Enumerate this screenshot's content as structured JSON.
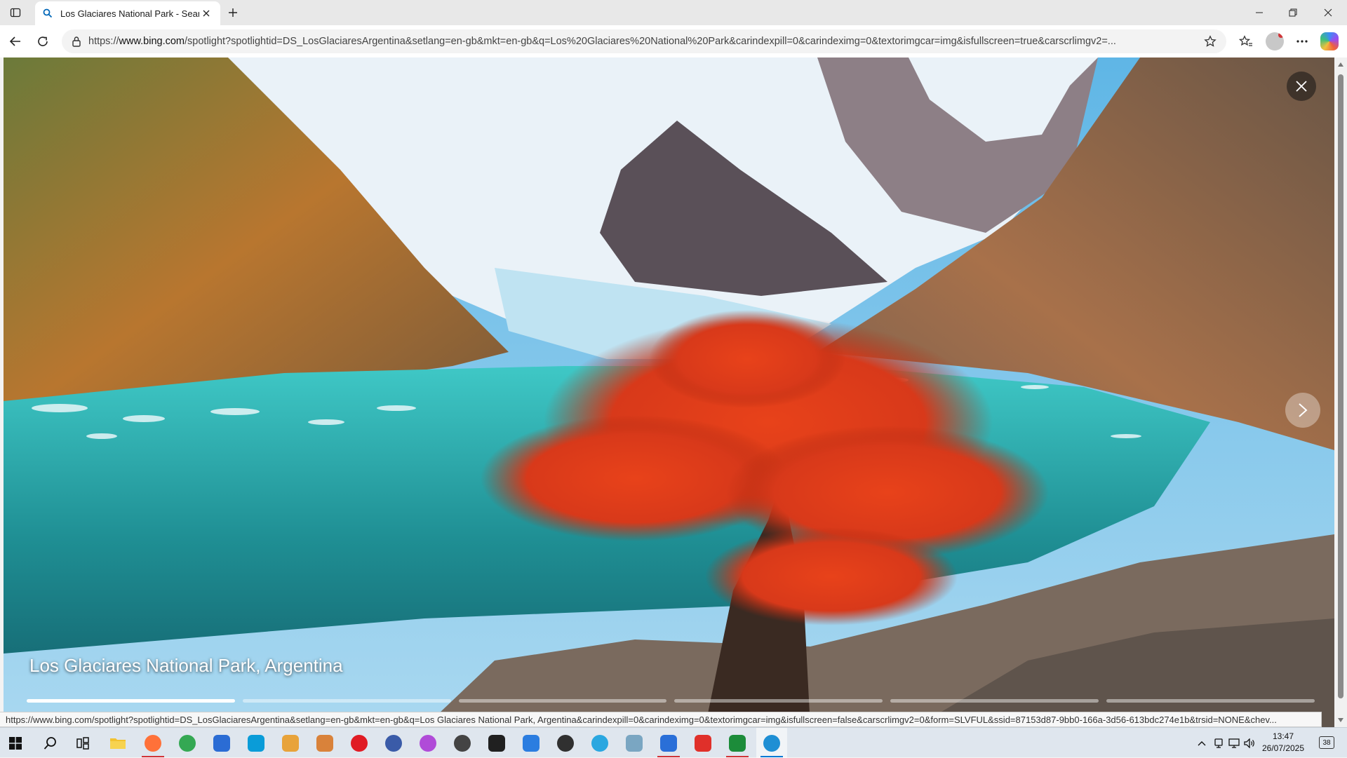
{
  "browser": {
    "tab": {
      "title": "Los Glaciares National Park - Search",
      "favicon": "search-icon"
    },
    "window_controls": [
      "minimize-icon",
      "restore-icon",
      "close-icon"
    ],
    "address_bar": {
      "url_prefix": "https://",
      "url_domain": "www.bing.com",
      "url_rest": "/spotlight?spotlightid=DS_LosGlaciaresArgentina&setlang=en-gb&mkt=en-gb&q=Los%20Glaciares%20National%20Park&carindexpill=0&carindeximg=0&textorimgcar=img&isfullscreen=true&carscrlimgv2=..."
    }
  },
  "viewer": {
    "caption": "Los Glaciares National Park, Argentina",
    "progress": {
      "segments": 6,
      "active_index": 0
    }
  },
  "status_url": "https://www.bing.com/spotlight?spotlightid=DS_LosGlaciaresArgentina&setlang=en-gb&mkt=en-gb&q=Los Glaciares National Park, Argentina&carindexpill=0&carindeximg=0&textorimgcar=img&isfullscreen=false&carscrlimgv2=0&form=SLVFUL&ssid=87153d87-9bb0-166a-3d56-613bdc274e1b&trsid=NONE&chev...",
  "taskbar": {
    "apps": [
      {
        "name": "firefox",
        "color": "#ff7139",
        "running": true
      },
      {
        "name": "chrome",
        "color": "#34a853",
        "running": false
      },
      {
        "name": "mail",
        "color": "#2b6cd4",
        "running": false
      },
      {
        "name": "remote-desktop",
        "color": "#0a9cd8",
        "running": false
      },
      {
        "name": "settings-app",
        "color": "#e8a33a",
        "running": false
      },
      {
        "name": "presentation",
        "color": "#d9823a",
        "running": false
      },
      {
        "name": "opera",
        "color": "#e01b24",
        "running": false
      },
      {
        "name": "vpn",
        "color": "#3a5ba8",
        "running": false
      },
      {
        "name": "photos",
        "color": "#b04bd8",
        "running": false
      },
      {
        "name": "davinci",
        "color": "#444444",
        "running": false
      },
      {
        "name": "xd-pen",
        "color": "#202020",
        "running": false
      },
      {
        "name": "fonts",
        "color": "#2b7de0",
        "running": false
      },
      {
        "name": "media",
        "color": "#303030",
        "running": false
      },
      {
        "name": "globe",
        "color": "#2aa7e0",
        "running": false
      },
      {
        "name": "draw",
        "color": "#7aa6c2",
        "running": false
      },
      {
        "name": "arc",
        "color": "#2a6fd8",
        "running": true
      },
      {
        "name": "wps",
        "color": "#e0302a",
        "running": false
      },
      {
        "name": "cu",
        "color": "#1c8c3a",
        "running": true
      },
      {
        "name": "edge",
        "color": "#1f8fd4",
        "running": true
      }
    ],
    "clock": {
      "time": "13:47",
      "date": "26/07/2025"
    },
    "notifications": "38"
  }
}
